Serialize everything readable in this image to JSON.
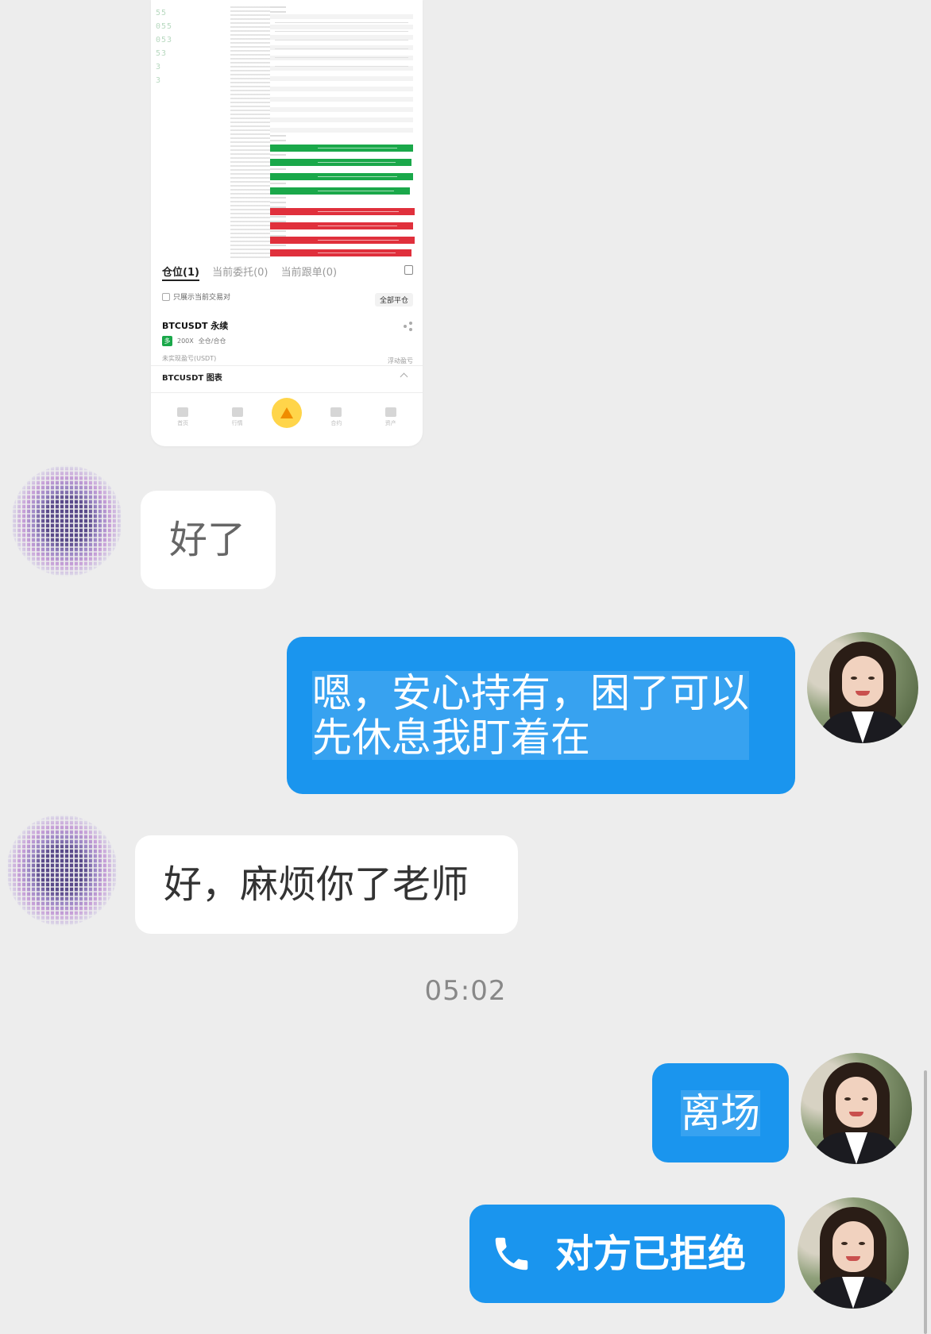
{
  "screenshot": {
    "price_column": [
      "",
      "",
      "",
      "",
      "",
      "",
      "",
      "",
      "",
      "",
      "55",
      "055",
      "053",
      "53",
      "3",
      "3",
      "",
      ""
    ],
    "tabs": [
      "仓位(1)",
      "当前委托(0)",
      "当前跟单(0)"
    ],
    "filter_label": "只展示当前交易对",
    "close_all": "全部平仓",
    "contract_name": "BTCUSDT 永续",
    "leverage": "200X",
    "margin_mode": "全仓/合仓",
    "unrealized_pnl_label": "未实现盈亏(USDT)",
    "floating_label": "浮动盈亏",
    "chart_label": "BTCUSDT 图表",
    "nav": [
      "首页",
      "行情",
      "",
      "合约",
      "资产"
    ],
    "accent_green": "#1aa84a",
    "accent_red": "#e0303c"
  },
  "messages": [
    {
      "side": "incoming",
      "text": "好了"
    },
    {
      "side": "outgoing",
      "line1": "嗯，安心持有，困了可以",
      "line2": "先休息我盯着在"
    },
    {
      "side": "incoming",
      "text": "好，麻烦你了老师"
    },
    {
      "side": "outgoing",
      "text": "离场"
    },
    {
      "side": "outgoing",
      "icon": "phone-icon",
      "text": "对方已拒绝"
    }
  ],
  "timestamp": "05:02",
  "colors": {
    "background": "#ededed",
    "outgoing_bubble": "#1a95ee",
    "incoming_bubble": "#ffffff"
  }
}
